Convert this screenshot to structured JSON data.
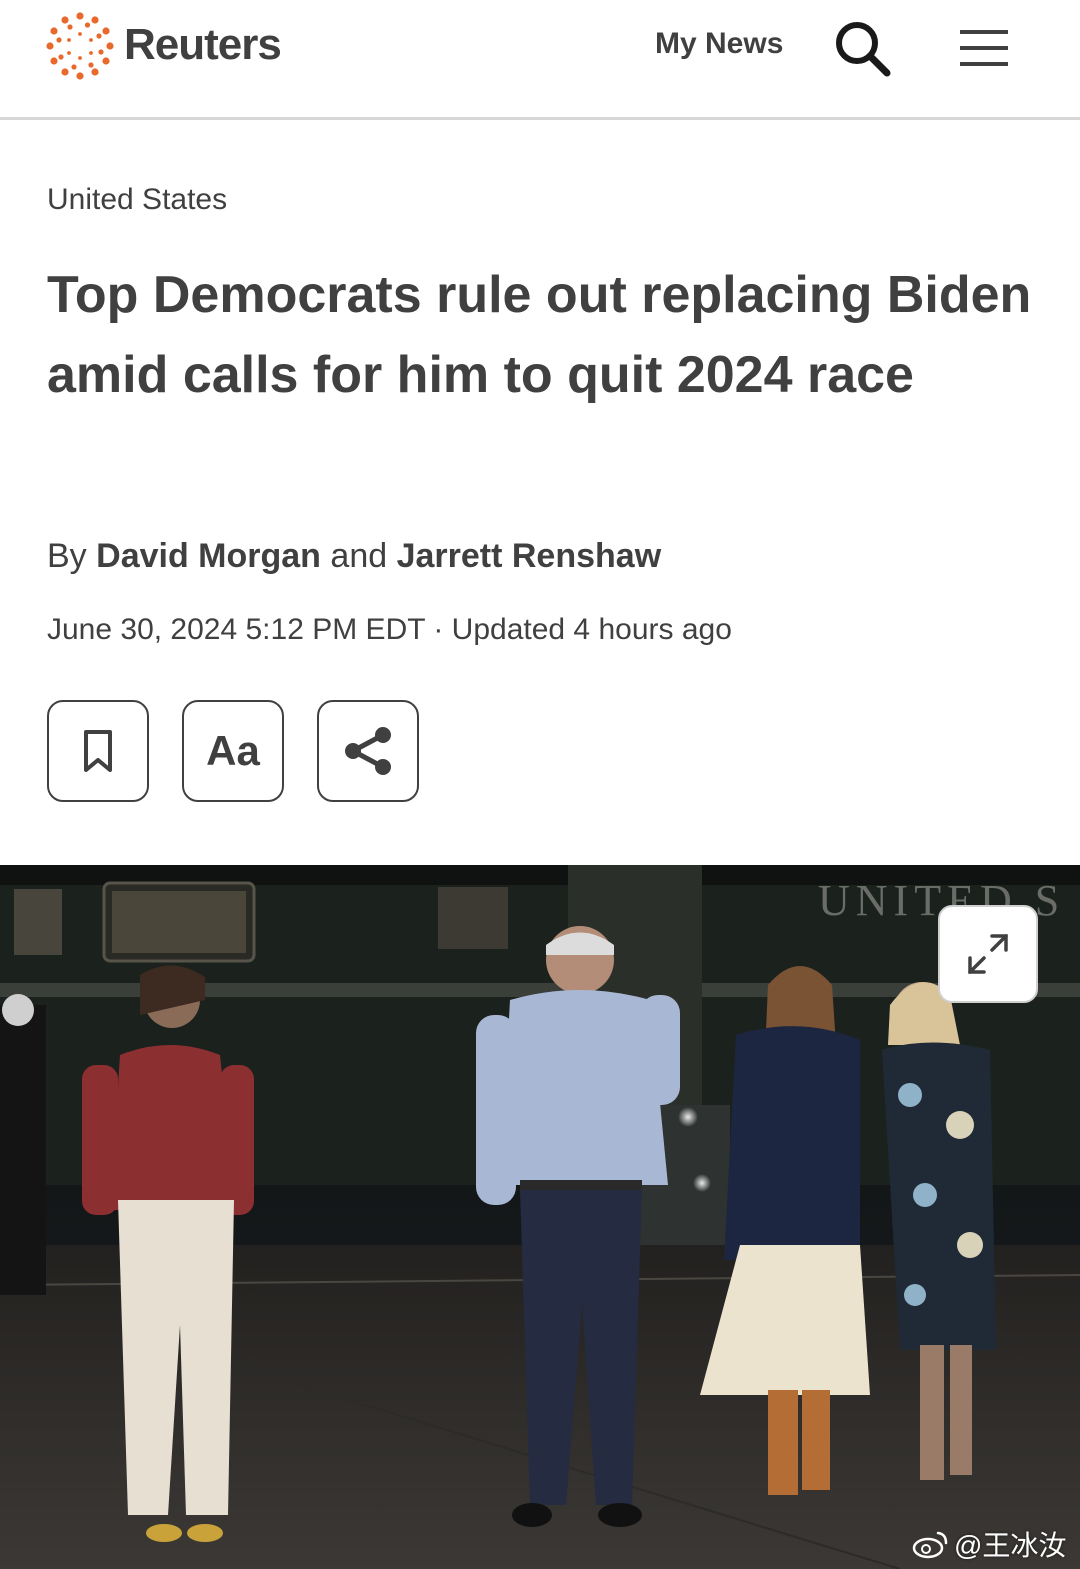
{
  "header": {
    "brand": "Reuters",
    "my_news_label": "My News"
  },
  "article": {
    "section": "United States",
    "headline": "Top Democrats rule out replacing Biden amid calls for him to quit 2024 race",
    "byline": {
      "prefix": "By",
      "author1": "David Morgan",
      "joiner": "and",
      "author2": "Jarrett Renshaw"
    },
    "dateline": "June 30, 2024 5:12 PM EDT · Updated 4 hours ago"
  },
  "tools": {
    "font_size_label": "Aa",
    "icons": [
      "bookmark-icon",
      "text-size-icon",
      "share-icon"
    ]
  },
  "photo": {
    "signage_text": "UNITED S",
    "expand_icon": "expand-icon"
  },
  "watermark": {
    "handle": "@王冰汝"
  },
  "colors": {
    "text": "#404040",
    "brand_orange": "#e8692c",
    "divider": "#d6d6d6"
  }
}
